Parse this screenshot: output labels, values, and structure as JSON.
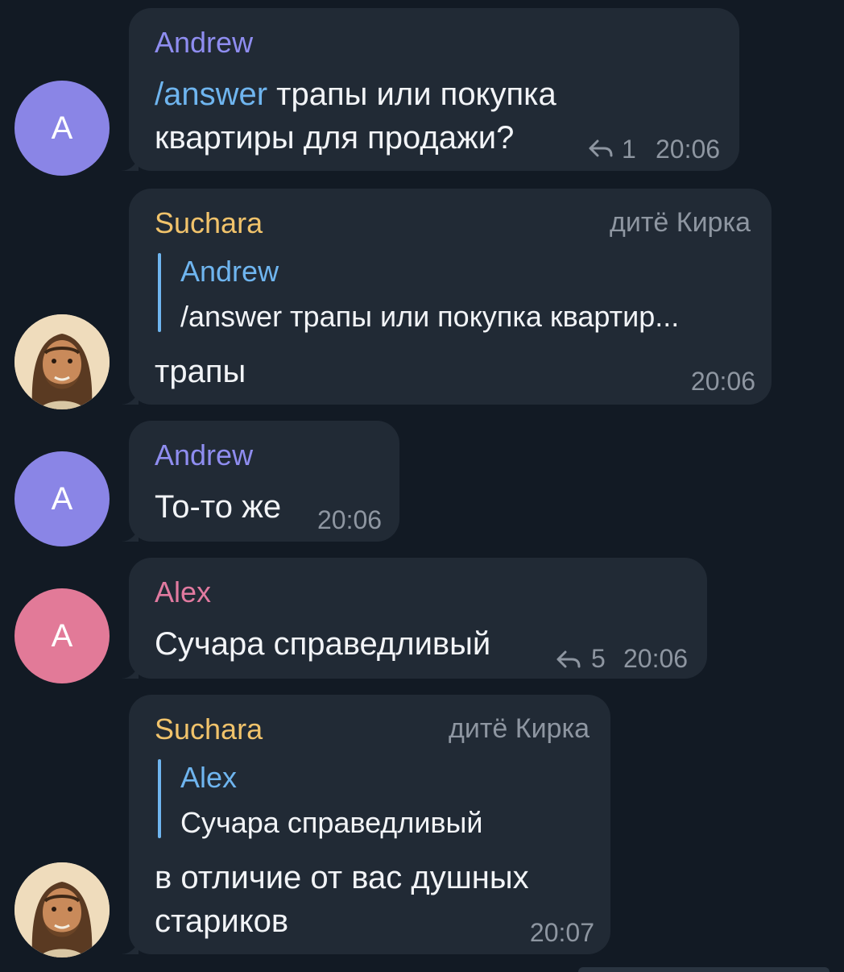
{
  "messages": [
    {
      "avatar_letter": "A",
      "avatar_color": "#8a85e6",
      "sender": "Andrew",
      "sender_color": "#8f8df0",
      "command": "/answer",
      "line1_rest": " трапы или покупка",
      "line2": "квартиры для продажи?",
      "replies": "1",
      "time": "20:06"
    },
    {
      "avatar_icon": "jesus-avatar",
      "sender": "Suchara",
      "sender_color": "#f1c36b",
      "rank": "дитё Кирка",
      "quote_name": "Andrew",
      "quote_text": "/answer трапы или покупка квартир...",
      "text": "трапы",
      "time": "20:06"
    },
    {
      "avatar_letter": "A",
      "avatar_color": "#8a85e6",
      "sender": "Andrew",
      "sender_color": "#8f8df0",
      "text": "То-то же",
      "time": "20:06"
    },
    {
      "avatar_letter": "A",
      "avatar_color": "#e27a98",
      "sender": "Alex",
      "sender_color": "#e17aa0",
      "text": "Сучара справедливый",
      "replies": "5",
      "time": "20:06"
    },
    {
      "avatar_icon": "jesus-avatar",
      "sender": "Suchara",
      "sender_color": "#f1c36b",
      "rank": "дитё Кирка",
      "quote_name": "Alex",
      "quote_text": "Сучара справедливый",
      "line1": "в отличие от вас душных",
      "line2": "стариков",
      "time": "20:07"
    }
  ]
}
